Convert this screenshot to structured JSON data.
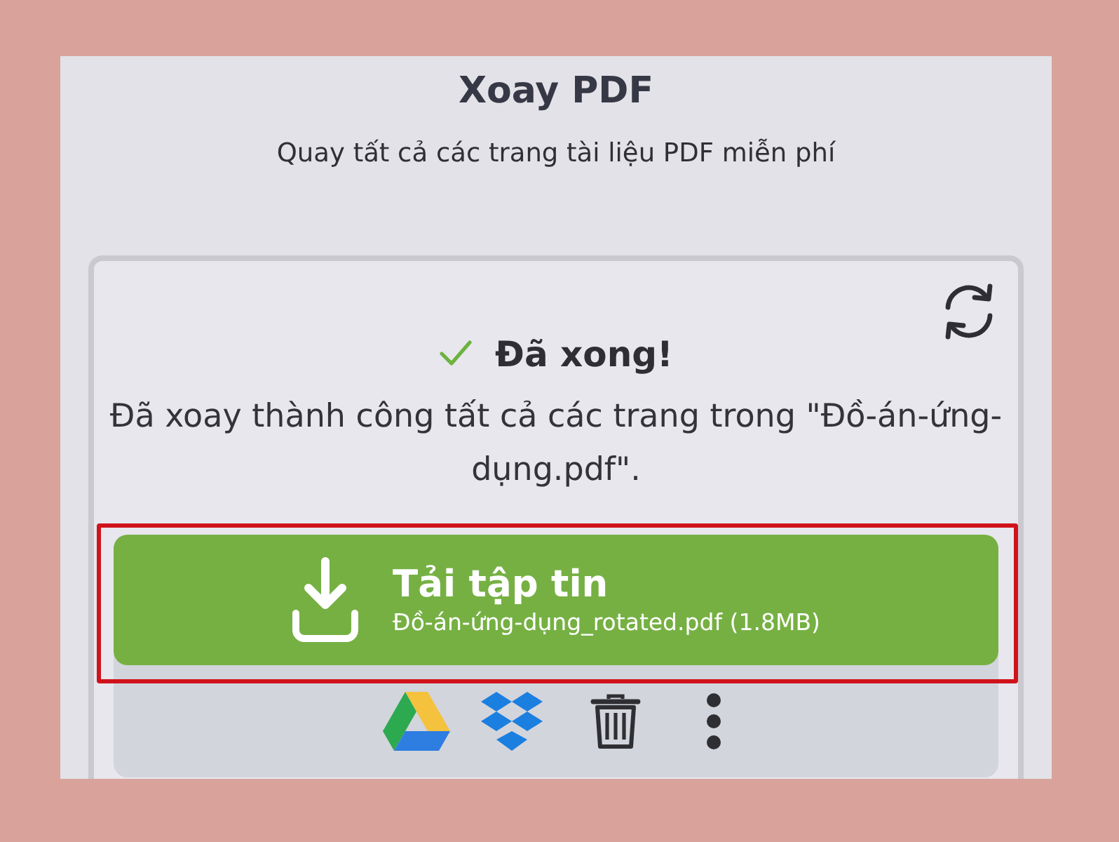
{
  "page": {
    "title": "Xoay PDF",
    "subtitle": "Quay tất cả các trang tài liệu PDF miễn phí"
  },
  "result": {
    "status": "Đã xong!",
    "message": "Đã xoay thành công tất cả các trang trong \"Đồ-án-ứng-dụng.pdf\".",
    "download": {
      "label": "Tải tập tin",
      "file": "Đồ-án-ứng-dụng_rotated.pdf (1.8MB)",
      "highlighted": true
    },
    "actions": [
      {
        "kind": "drive"
      },
      {
        "kind": "dropbox"
      },
      {
        "kind": "delete"
      },
      {
        "kind": "more"
      }
    ]
  }
}
